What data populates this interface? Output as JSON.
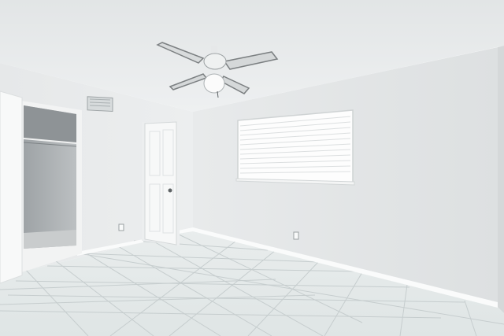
{
  "scene": {
    "subject": "empty-room",
    "colors": {
      "ceiling": "#eef0f1",
      "wall_left": "#e9ebec",
      "wall_right": "#e4e6e7",
      "floor_tile": "#e7ecec",
      "grout": "#c8cfd0",
      "door": "#f6f7f7",
      "baseboard": "#f7f8f8",
      "closet_interior": "#b3b7b9",
      "window_blinds": "#f4f5f5"
    }
  }
}
